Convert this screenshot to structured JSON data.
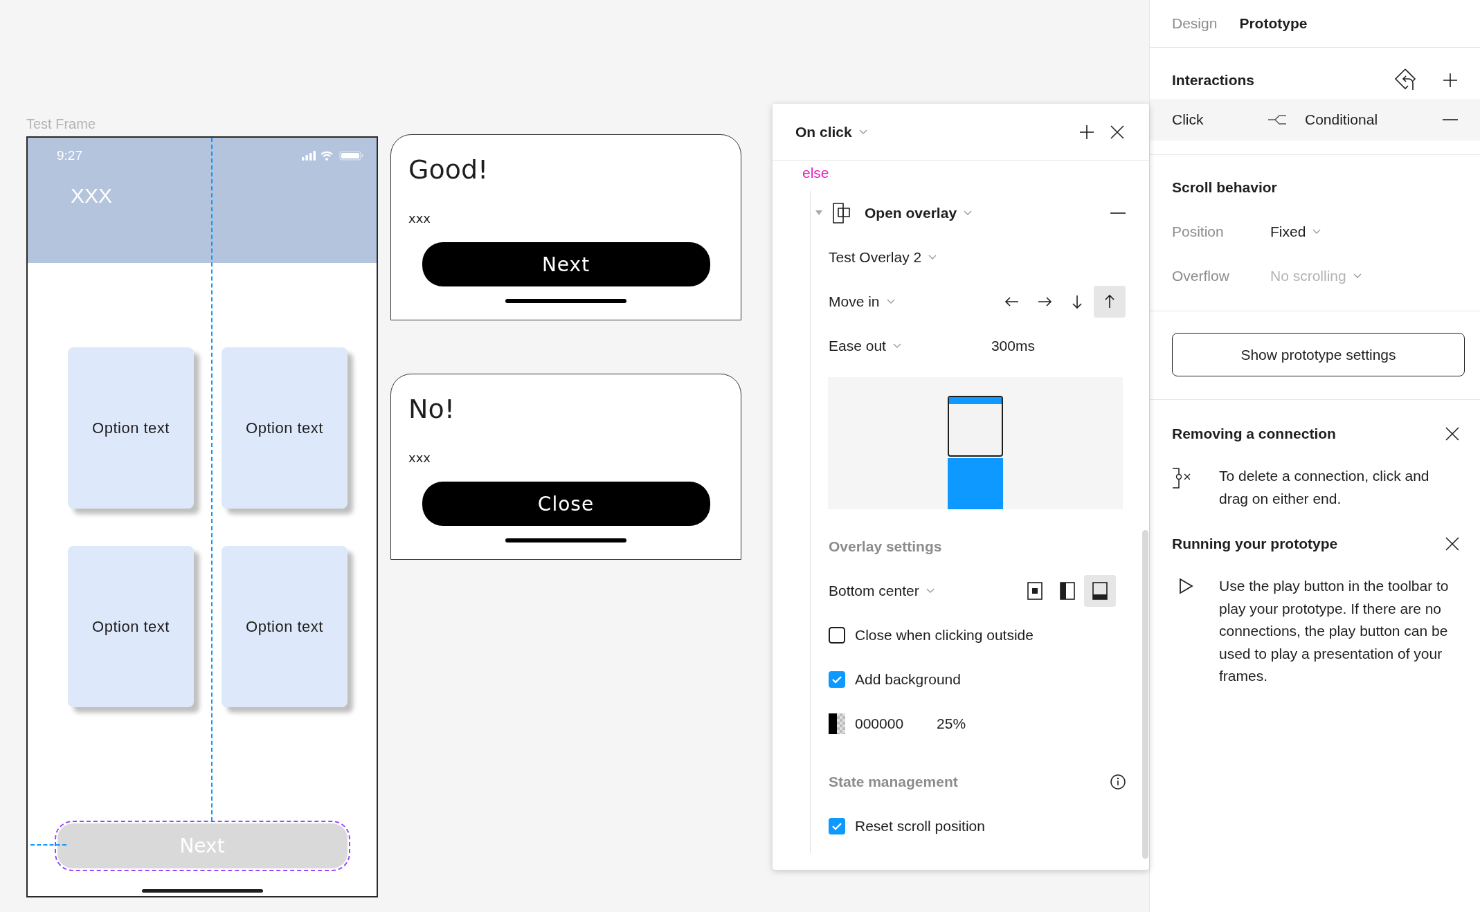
{
  "canvas": {
    "frame": {
      "label": "Test Frame",
      "time": "9:27",
      "title": "XXX",
      "options": [
        {
          "label": "Option text"
        },
        {
          "label": "Option text"
        },
        {
          "label": "Option text"
        },
        {
          "label": "Option text"
        }
      ],
      "next_button": {
        "label": "Next",
        "disabled": true,
        "selected": true
      }
    },
    "overlays": [
      {
        "title": "Good!",
        "body": "xxx",
        "button": "Next"
      },
      {
        "title": "No!",
        "body": "xxx",
        "button": "Close"
      }
    ]
  },
  "interaction_popup": {
    "trigger": "On click",
    "branch": "else",
    "action": {
      "label": "Open overlay",
      "expanded": true
    },
    "destination": "Test Overlay 2",
    "animation": "Move in",
    "directions": [
      {
        "kind": "left",
        "selected": false
      },
      {
        "kind": "right",
        "selected": false
      },
      {
        "kind": "down",
        "selected": false
      },
      {
        "kind": "up",
        "selected": true
      }
    ],
    "easing": "Ease out",
    "duration": "300ms",
    "overlay_settings": {
      "heading": "Overlay settings",
      "position": "Bottom center",
      "position_options": [
        {
          "kind": "center",
          "selected": false
        },
        {
          "kind": "side",
          "selected": false
        },
        {
          "kind": "bottom",
          "selected": true
        }
      ],
      "close_outside": {
        "label": "Close when clicking outside",
        "checked": false
      },
      "add_background": {
        "label": "Add background",
        "checked": true
      },
      "background_color": {
        "hex": "000000",
        "opacity": "25%"
      }
    },
    "state_management": {
      "heading": "State management",
      "reset_scroll": {
        "label": "Reset scroll position",
        "checked": true
      }
    }
  },
  "panel": {
    "tabs": [
      {
        "label": "Design",
        "selected": false
      },
      {
        "label": "Prototype",
        "selected": true
      }
    ],
    "interactions": {
      "heading": "Interactions",
      "rows": [
        {
          "trigger": "Click",
          "action": "Conditional"
        }
      ]
    },
    "scroll_behavior": {
      "heading": "Scroll behavior",
      "fields": [
        {
          "label": "Position",
          "value": "Fixed",
          "disabled": false
        },
        {
          "label": "Overflow",
          "value": "No scrolling",
          "disabled": true
        }
      ]
    },
    "settings_button": "Show prototype settings",
    "tips": [
      {
        "kind": "connection",
        "title": "Removing a connection",
        "text": "To delete a connection, click and drag on either end."
      },
      {
        "kind": "play",
        "title": "Running your prototype",
        "text": "Use the play button in the toolbar to play your prototype. If there are no connections, the play button can be used to play a presentation of your frames."
      }
    ]
  }
}
